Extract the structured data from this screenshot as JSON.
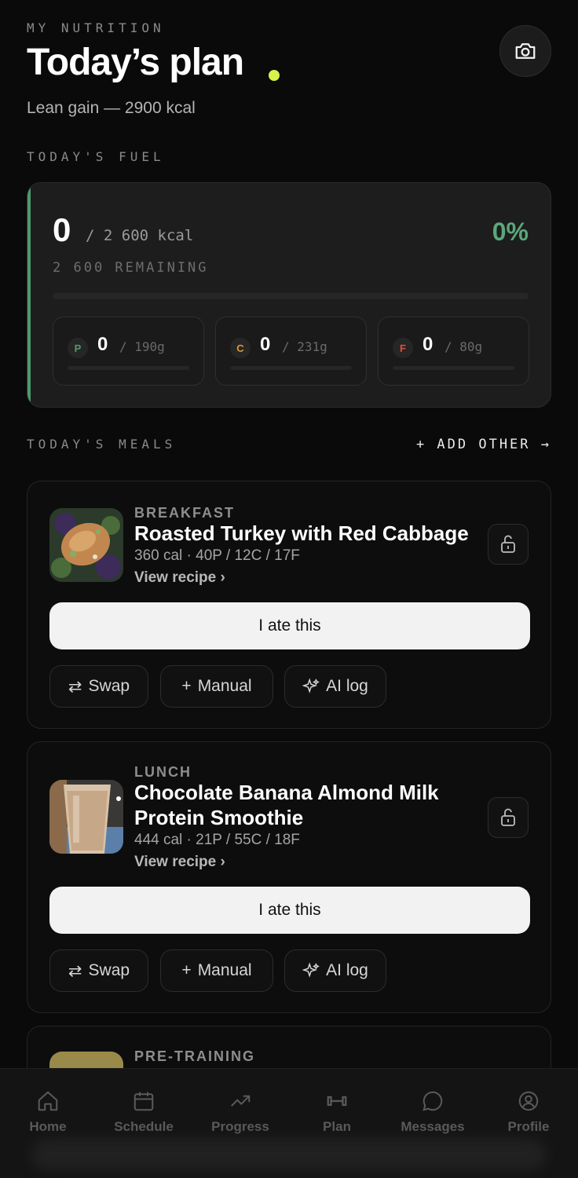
{
  "header": {
    "eyebrow": "MY NUTRITION",
    "title": "Today’s plan",
    "subtitle": "Lean gain — 2900 kcal",
    "accent_dot_color": "#d7f24a",
    "camera_icon": "camera-icon"
  },
  "fuel": {
    "section_label": "TODAY'S FUEL",
    "consumed": "0",
    "target_text": "/ 2 600 kcal",
    "percent": "0%",
    "progress": 0,
    "remaining": "2 600 REMAINING",
    "accent_color": "#5ba77b",
    "macros": [
      {
        "letter": "P",
        "value": "0",
        "target": "/ 190g",
        "color": "#4f9a6d",
        "progress": 0
      },
      {
        "letter": "C",
        "value": "0",
        "target": "/ 231g",
        "color": "#d49a3a",
        "progress": 0
      },
      {
        "letter": "F",
        "value": "0",
        "target": "/ 80g",
        "color": "#e0503c",
        "progress": 0
      }
    ]
  },
  "meals_section": {
    "label": "TODAY'S MEALS",
    "add_other": "+ ADD OTHER →"
  },
  "meals": [
    {
      "label": "BREAKFAST",
      "name": "Roasted Turkey with Red Cabbage",
      "macros": "360 cal · 40P / 12C / 17F",
      "recipe": "View recipe ›",
      "ate": "I ate this",
      "swap": "Swap",
      "manual": "Manual",
      "ai": "AI log"
    },
    {
      "label": "LUNCH",
      "name": "Chocolate Banana Almond Milk Protein Smoothie",
      "macros": "444 cal · 21P / 55C / 18F",
      "recipe": "View recipe ›",
      "ate": "I ate this",
      "swap": "Swap",
      "manual": "Manual",
      "ai": "AI log"
    },
    {
      "label": "PRE-TRAINING"
    }
  ],
  "tabs": [
    {
      "label": "Home",
      "icon": "home-icon"
    },
    {
      "label": "Schedule",
      "icon": "calendar-icon"
    },
    {
      "label": "Progress",
      "icon": "trend-icon"
    },
    {
      "label": "Plan",
      "icon": "dumbbell-icon"
    },
    {
      "label": "Messages",
      "icon": "chat-icon"
    },
    {
      "label": "Profile",
      "icon": "profile-icon"
    }
  ]
}
